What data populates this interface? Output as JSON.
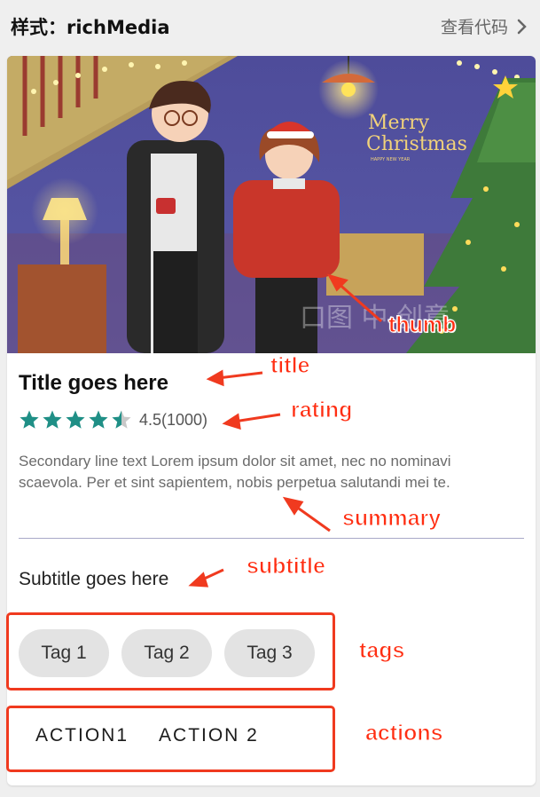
{
  "header": {
    "title": "样式：richMedia",
    "view_code": "查看代码"
  },
  "card": {
    "thumb_text": {
      "merry": "Merry",
      "christmas": "Christmas",
      "tiny": "HAPPY NEW YEAR"
    },
    "title": "Title goes here",
    "rating": {
      "value": 4.5,
      "max": 5,
      "text": "4.5(1000)",
      "star_color": "#1f8f86"
    },
    "summary": "Secondary line text Lorem ipsum dolor sit amet, nec no nominavi scaevola. Per et sint sapientem, nobis perpetua salutandi mei te.",
    "subtitle": "Subtitle goes here",
    "tags": [
      "Tag 1",
      "Tag 2",
      "Tag 3"
    ],
    "actions": [
      "ACTION1",
      "ACTION 2"
    ]
  },
  "annotations": {
    "thumb": "thumb",
    "title": "title",
    "rating": "rating",
    "summary": "summary",
    "subtitle": "subtitle",
    "tags": "tags",
    "actions": "actions",
    "color": "#f03a1f"
  }
}
